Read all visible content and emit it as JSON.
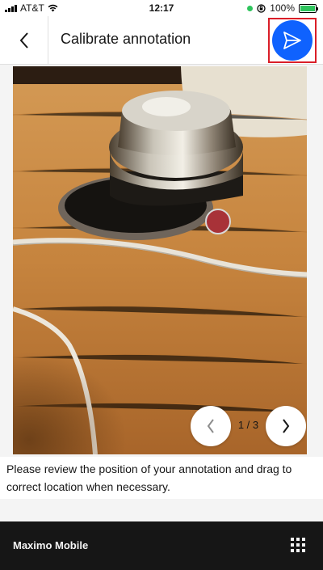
{
  "status_bar": {
    "carrier": "AT&T",
    "time": "12:17",
    "battery": "100%"
  },
  "header": {
    "title": "Calibrate annotation",
    "back_icon": "chevron-left-icon",
    "send_icon": "send-icon"
  },
  "photo": {
    "pager": {
      "current": 1,
      "total": 3,
      "label": "1 / 3"
    }
  },
  "instruction": {
    "text": "Please review the position of your annotation and drag to correct location when necessary."
  },
  "footer": {
    "title": "Maximo Mobile",
    "menu_icon": "app-grid-icon"
  },
  "colors": {
    "accent": "#0f62fe",
    "highlight": "#da1e28",
    "marker": "#a83238",
    "footer_bg": "#161616"
  }
}
